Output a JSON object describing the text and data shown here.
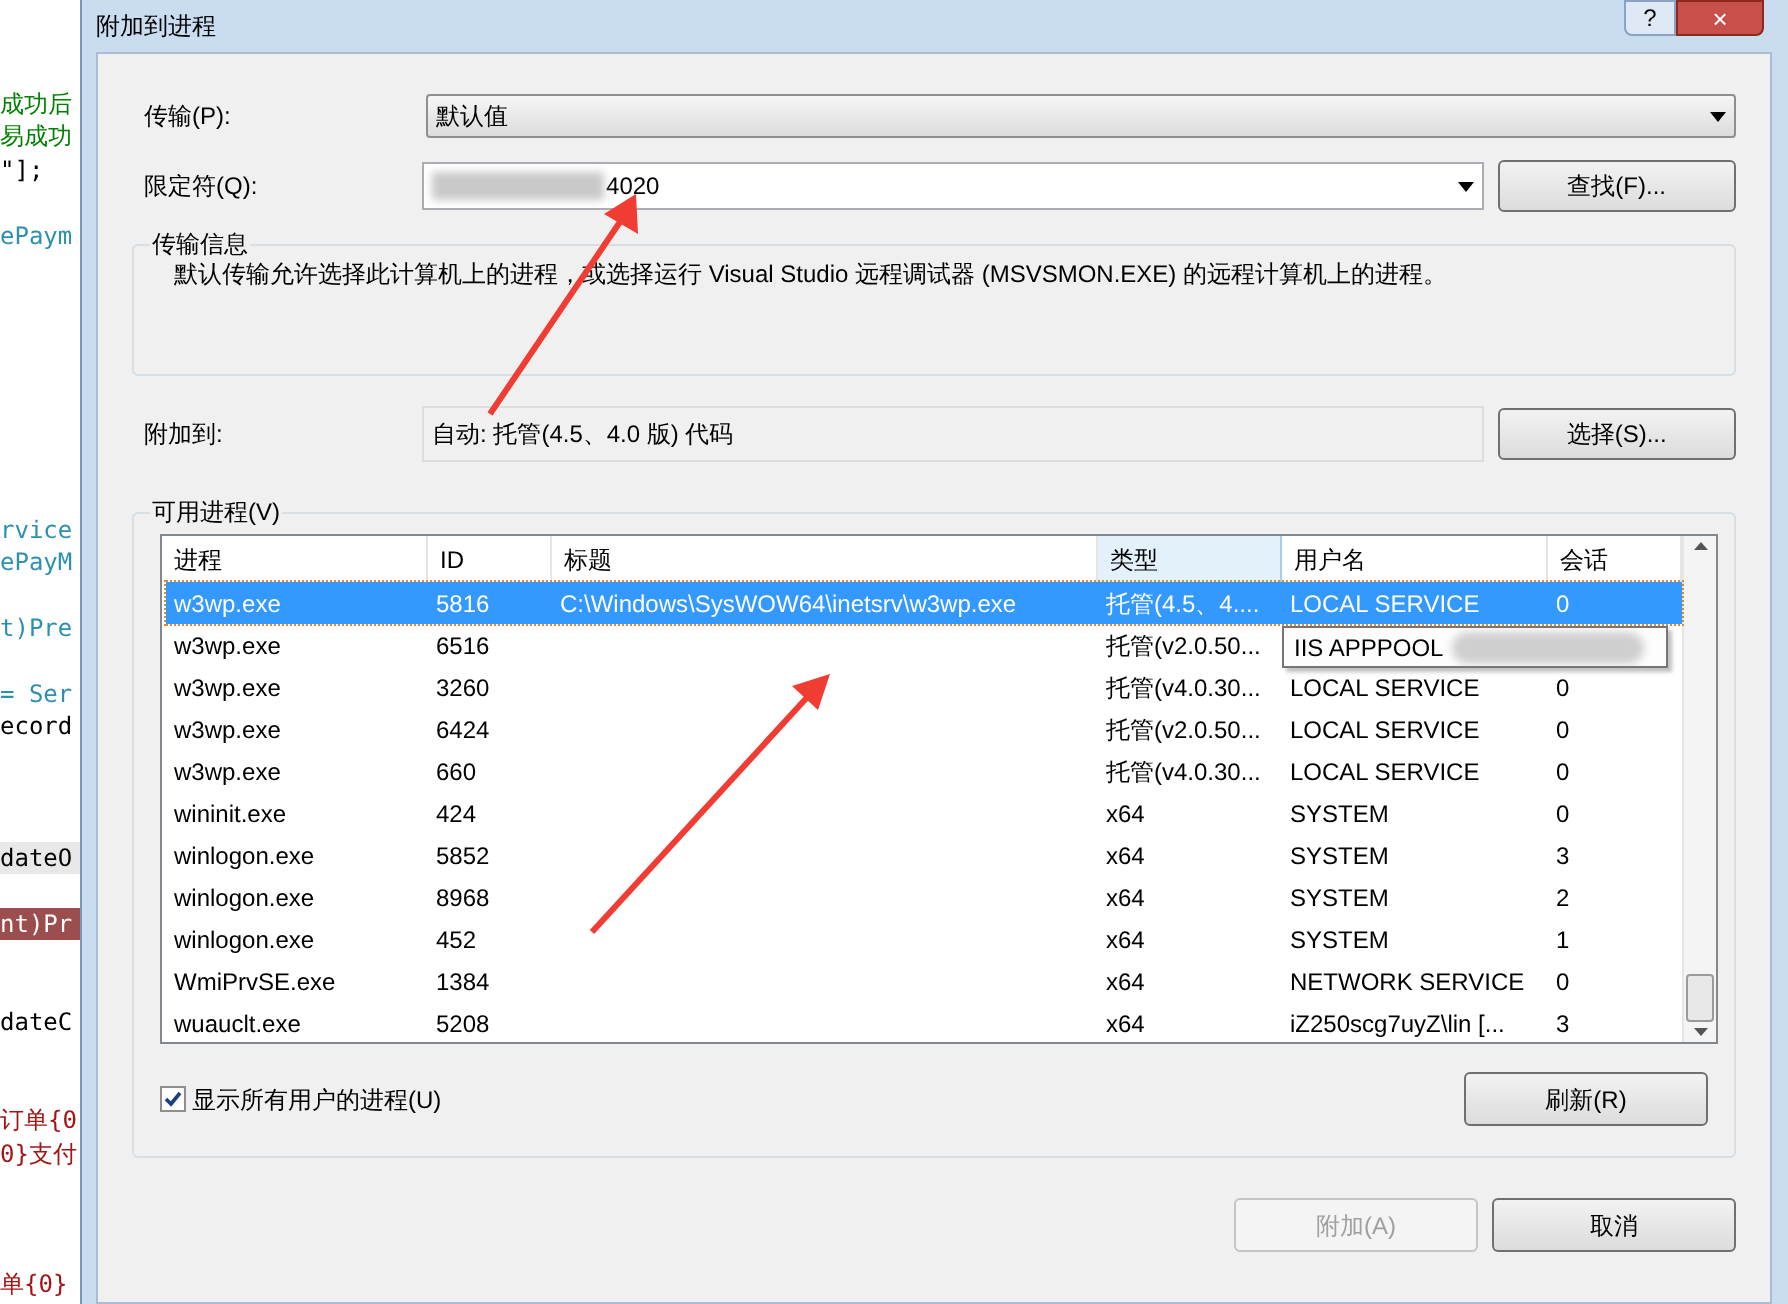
{
  "editor": {
    "lines": [
      {
        "text": "成功后",
        "kind": "comment"
      },
      {
        "text": "易成功",
        "kind": "comment"
      },
      {
        "text": "\"];",
        "kind": "plain"
      },
      {
        "text": "ePaym",
        "kind": "type"
      },
      {
        "text": "rvice",
        "kind": "type"
      },
      {
        "text": "ePayM",
        "kind": "type"
      },
      {
        "text": "t)Pre",
        "kind": "type"
      },
      {
        "text": "= Ser",
        "kind": "type"
      },
      {
        "text": "ecord",
        "kind": "plain"
      },
      {
        "text": "dateO",
        "kind": "current"
      },
      {
        "text": "nt)Pr",
        "kind": "breakpoint"
      },
      {
        "text": "dateC",
        "kind": "plain"
      },
      {
        "text": "订单{0",
        "kind": "string"
      },
      {
        "text": "0}支付",
        "kind": "string"
      },
      {
        "text": "单{0}",
        "kind": "string"
      }
    ]
  },
  "window": {
    "title": "附加到进程",
    "help": "?",
    "close": "×"
  },
  "transport": {
    "label": "传输(P):",
    "value": "默认值"
  },
  "qualifier": {
    "label": "限定符(Q):",
    "value": "4020",
    "find_button": "查找(F)..."
  },
  "transport_info": {
    "title": "传输信息",
    "text": "默认传输允许选择此计算机上的进程，或选择运行 Visual Studio 远程调试器 (MSVSMON.EXE) 的远程计算机上的进程。"
  },
  "attach_to": {
    "label": "附加到:",
    "value": "自动: 托管(4.5、4.0 版) 代码",
    "select_button": "选择(S)..."
  },
  "processes": {
    "title": "可用进程(V)",
    "columns": [
      {
        "label": "进程",
        "hovered": false
      },
      {
        "label": "ID",
        "hovered": false
      },
      {
        "label": "标题",
        "hovered": false
      },
      {
        "label": "类型",
        "hovered": true
      },
      {
        "label": "用户名",
        "hovered": false
      },
      {
        "label": "会话",
        "hovered": false
      }
    ],
    "rows": [
      {
        "selected": true,
        "cells": [
          "w3wp.exe",
          "5816",
          "C:\\Windows\\SysWOW64\\inetsrv\\w3wp.exe",
          "托管(4.5、4....",
          "LOCAL SERVICE",
          "0"
        ]
      },
      {
        "selected": false,
        "cells": [
          "w3wp.exe",
          "6516",
          "",
          "托管(v2.0.50...",
          "",
          ""
        ]
      },
      {
        "selected": false,
        "cells": [
          "w3wp.exe",
          "3260",
          "",
          "托管(v4.0.30...",
          "LOCAL SERVICE",
          "0"
        ]
      },
      {
        "selected": false,
        "cells": [
          "w3wp.exe",
          "6424",
          "",
          "托管(v2.0.50...",
          "LOCAL SERVICE",
          "0"
        ]
      },
      {
        "selected": false,
        "cells": [
          "w3wp.exe",
          "660",
          "",
          "托管(v4.0.30...",
          "LOCAL SERVICE",
          "0"
        ]
      },
      {
        "selected": false,
        "cells": [
          "wininit.exe",
          "424",
          "",
          "x64",
          "SYSTEM",
          "0"
        ]
      },
      {
        "selected": false,
        "cells": [
          "winlogon.exe",
          "5852",
          "",
          "x64",
          "SYSTEM",
          "3"
        ]
      },
      {
        "selected": false,
        "cells": [
          "winlogon.exe",
          "8968",
          "",
          "x64",
          "SYSTEM",
          "2"
        ]
      },
      {
        "selected": false,
        "cells": [
          "winlogon.exe",
          "452",
          "",
          "x64",
          "SYSTEM",
          "1"
        ]
      },
      {
        "selected": false,
        "cells": [
          "WmiPrvSE.exe",
          "1384",
          "",
          "x64",
          "NETWORK SERVICE",
          "0"
        ]
      },
      {
        "selected": false,
        "cells": [
          "wuauclt.exe",
          "5208",
          "",
          "x64",
          "iZ250scg7uyZ\\lin [...",
          "3"
        ]
      }
    ],
    "tooltip": "IIS APPPOOL",
    "show_all_users": {
      "label": "显示所有用户的进程(U)",
      "checked": true
    },
    "refresh_button": "刷新(R)"
  },
  "buttons": [
    {
      "label": "附加(A)",
      "disabled": true
    },
    {
      "label": "取消",
      "disabled": false
    }
  ]
}
